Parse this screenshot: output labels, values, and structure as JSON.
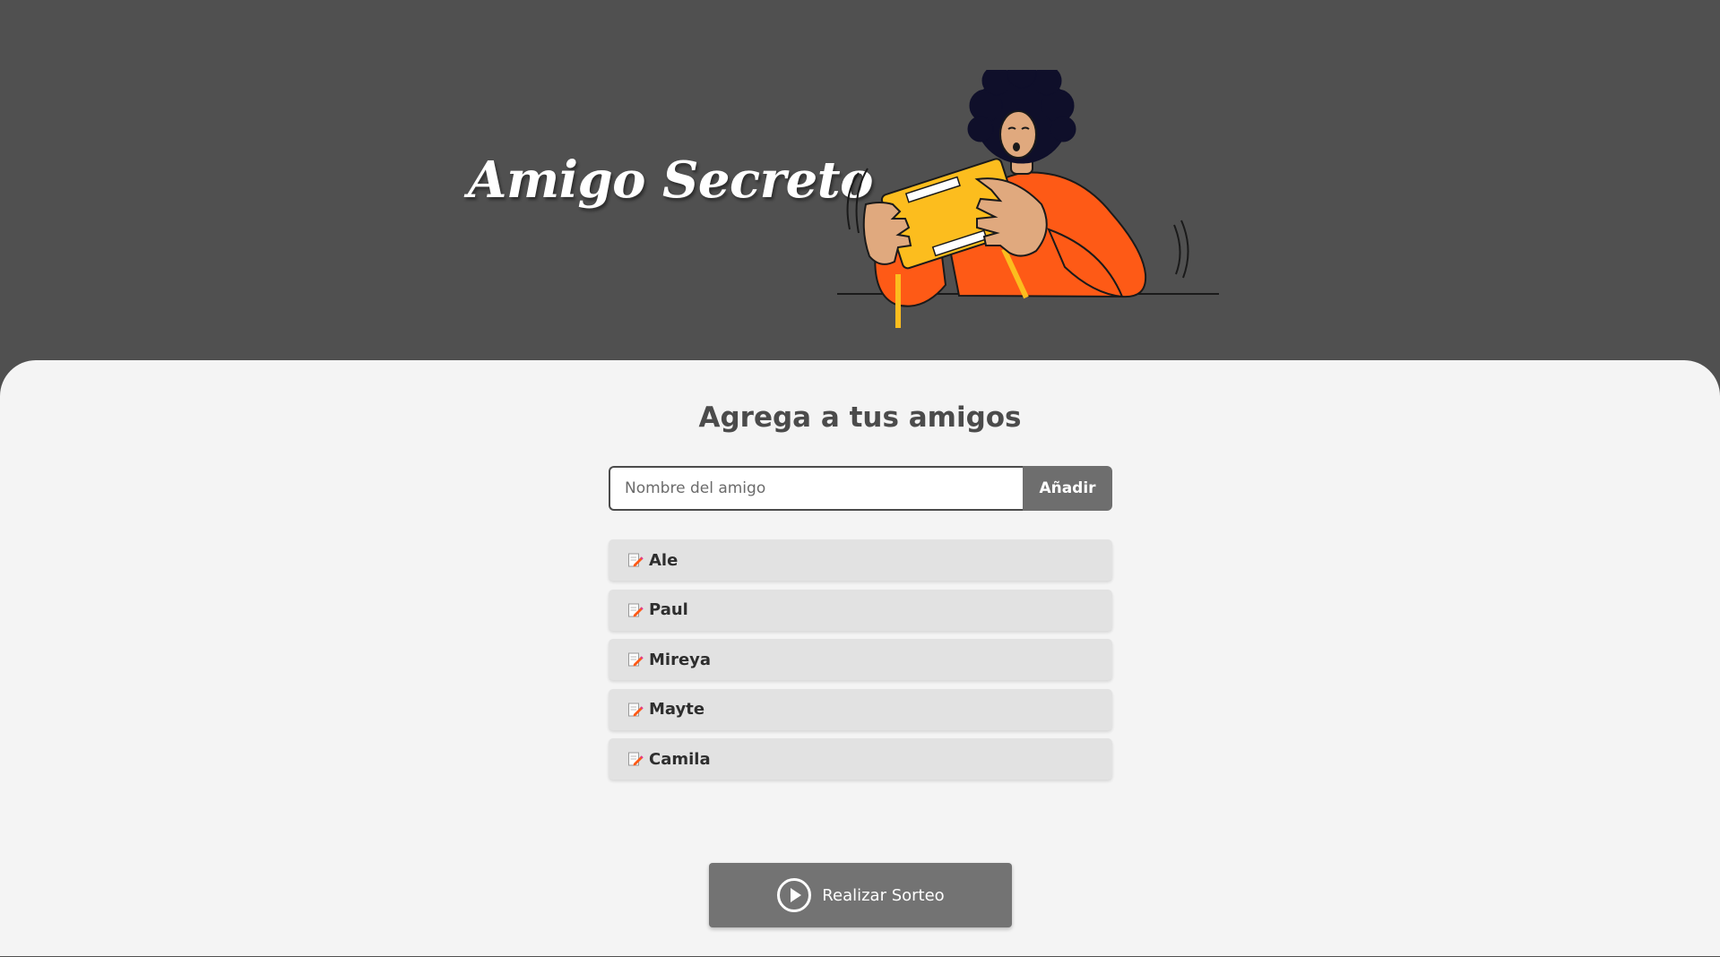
{
  "header": {
    "title": "Amigo Secreto",
    "illustration": "person-holding-gift-box-illustration"
  },
  "main": {
    "subtitle": "Agrega a tus amigos",
    "input": {
      "placeholder": "Nombre del amigo",
      "value": ""
    },
    "add_button_label": "Añadir",
    "friends": [
      {
        "icon": "memo-icon",
        "name": "Ale"
      },
      {
        "icon": "memo-icon",
        "name": "Paul"
      },
      {
        "icon": "memo-icon",
        "name": "Mireya"
      },
      {
        "icon": "memo-icon",
        "name": "Mayte"
      },
      {
        "icon": "memo-icon",
        "name": "Camila"
      }
    ],
    "draw_button": {
      "icon": "play-icon",
      "label": "Realizar Sorteo"
    }
  },
  "colors": {
    "header_bg": "#505050",
    "content_bg": "#f4f4f4",
    "button_bg": "#737373",
    "list_item_bg": "#e2e2e2",
    "accent_orange": "#fe5a16",
    "accent_yellow": "#fcbd1e"
  }
}
